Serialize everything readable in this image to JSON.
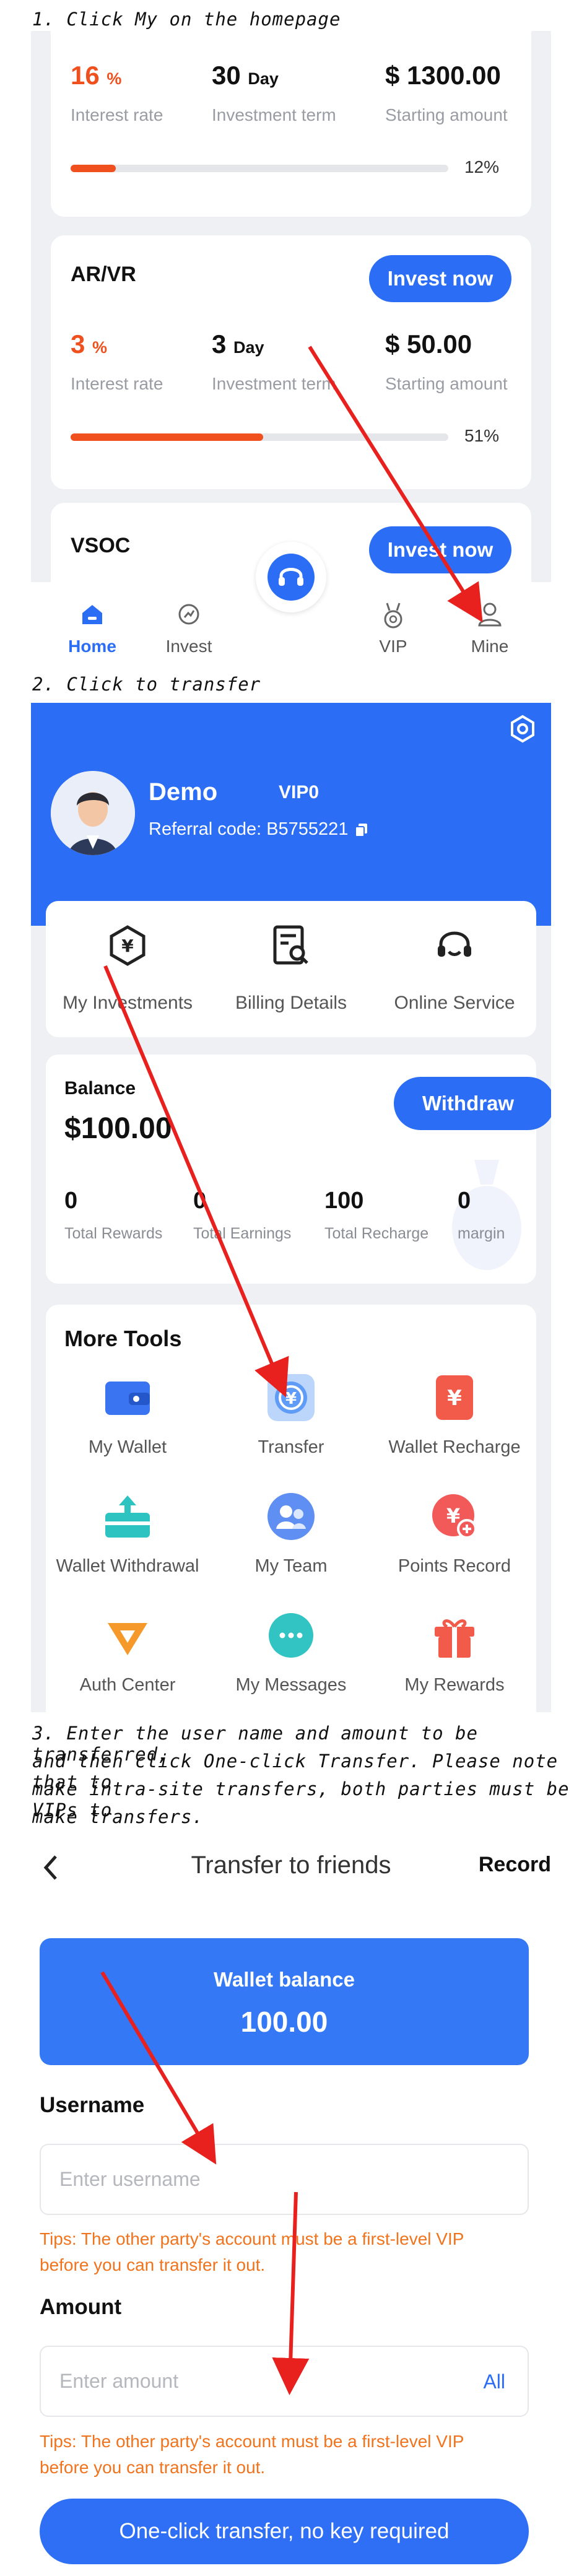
{
  "steps": {
    "s1": "1. Click My on the homepage",
    "s2": "2. Click to transfer",
    "s3_line1": "3. Enter the user name and amount to be transferred,",
    "s3_line2": "and then click One-click Transfer. Please note that to",
    "s3_line3": "make intra-site transfers, both parties must be VIPs to",
    "s3_line4": "make transfers."
  },
  "home": {
    "card1": {
      "rate": "16",
      "rate_unit": "%",
      "term": "30",
      "term_unit": "Day",
      "amount": "$ 1300.00",
      "rate_label": "Interest rate",
      "term_label": "Investment term",
      "amount_label": "Starting amount",
      "progress_text": "12%",
      "progress": 0.12
    },
    "card2": {
      "name": "AR/VR",
      "button": "Invest now",
      "rate": "3",
      "rate_unit": "%",
      "term": "3",
      "term_unit": "Day",
      "amount": "$ 50.00",
      "rate_label": "Interest rate",
      "term_label": "Investment term",
      "amount_label": "Starting amount",
      "progress_text": "51%",
      "progress": 0.51
    },
    "card3": {
      "name": "VSOC",
      "button": "Invest now"
    },
    "tabs": {
      "home": "Home",
      "invest": "Invest",
      "vip": "VIP",
      "mine": "Mine"
    }
  },
  "mine": {
    "username": "Demo",
    "vip": "VIP0",
    "referral": "Referral code:  B5755221",
    "services": [
      "My Investments",
      "Billing Details",
      "Online Service"
    ],
    "balance_label": "Balance",
    "balance": "$100.00",
    "withdraw": "Withdraw",
    "metrics": [
      {
        "value": "0",
        "label": "Total Rewards"
      },
      {
        "value": "0",
        "label": "Total Earnings"
      },
      {
        "value": "100",
        "label": "Total Recharge"
      },
      {
        "value": "0",
        "label": "margin"
      }
    ],
    "tools_title": "More Tools",
    "tools": [
      "My Wallet",
      "Transfer",
      "Wallet Recharge",
      "Wallet Withdrawal",
      "My Team",
      "Points Record",
      "Auth Center",
      "My Messages",
      "My Rewards"
    ]
  },
  "transfer": {
    "title": "Transfer to friends",
    "record": "Record",
    "wallet_label": "Wallet balance",
    "wallet_value": "100.00",
    "username_label": "Username",
    "username_placeholder": "Enter username",
    "tip1_line1": "Tips: The other party's account must be a first-level VIP",
    "tip1_line2": "before you can transfer it out.",
    "amount_label": "Amount",
    "amount_placeholder": "Enter amount",
    "all": "All",
    "tip2_line1": "Tips: The other party's account must be a first-level VIP",
    "tip2_line2": "before you can transfer it out.",
    "submit": "One-click transfer, no key required"
  },
  "colors": {
    "primary": "#2b6ef5",
    "accent": "#f0501e",
    "tips": "#f0741e",
    "arrow": "#e8201e"
  }
}
